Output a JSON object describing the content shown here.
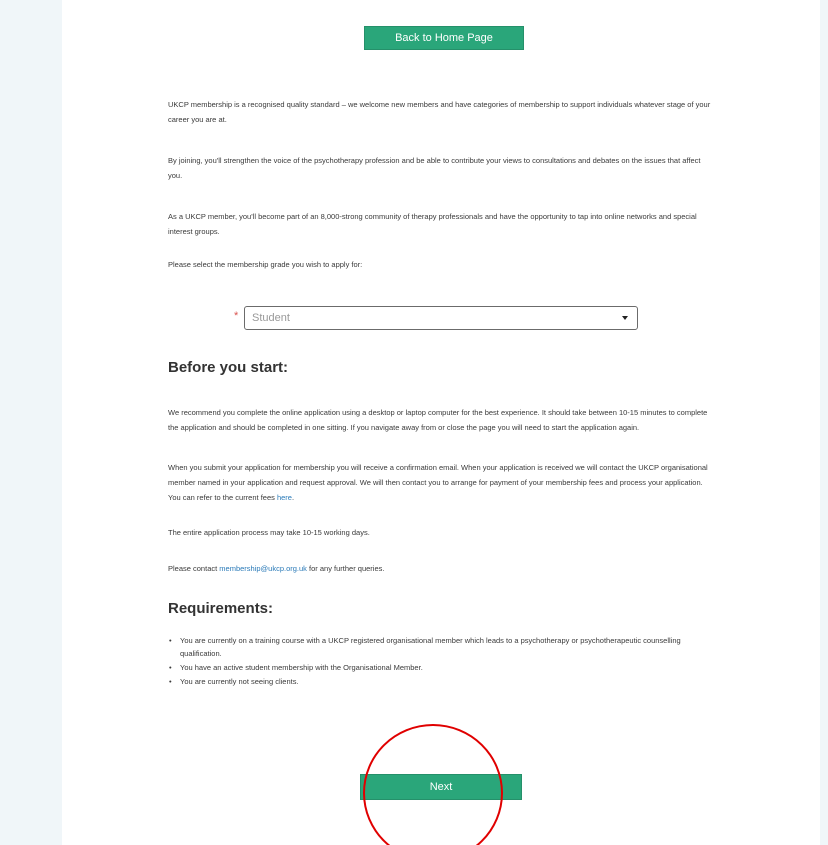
{
  "header": {
    "back_button_label": "Back to Home Page"
  },
  "intro": {
    "paragraphs": [
      "UKCP membership is a recognised quality standard – we welcome new members and have categories of membership to support individuals whatever stage of your career you are at.",
      "By joining, you'll strengthen the voice of the psychotherapy profession and be able to contribute your views to consultations and debates on the issues that affect you.",
      "As a UKCP member, you'll become part of an 8,000-strong community of therapy professionals and have the opportunity to tap into online networks and special interest groups.",
      "Please select the membership grade you wish to apply for:"
    ]
  },
  "grade_select": {
    "required_mark": "*",
    "selected_value": "Student"
  },
  "before_you_start": {
    "heading": "Before you start:",
    "p1": "We recommend you complete the online application using a desktop or laptop computer for the best experience. It should take between 10-15 minutes to complete the application and should be completed in one sitting. If you navigate away from or close the page you will need to start the application again.",
    "p2_text": "When you submit your application for membership you will receive a confirmation email. When your application is received we will contact the UKCP organisational member named in your application and request approval. We will then contact you to arrange for payment of your membership fees and process your application. You can refer to the current fees ",
    "p2_link": "here",
    "p2_end": ".",
    "p3": "The entire application process may take 10-15 working days.",
    "p4_text": "Please contact ",
    "p4_link": "membership@ukcp.org.uk",
    "p4_end": " for any further queries."
  },
  "requirements": {
    "heading": "Requirements:",
    "bullet": "•",
    "items": [
      "You are currently on a training course with a UKCP registered organisational member which leads to a psychotherapy or psychotherapeutic counselling qualification.",
      "You have an active student membership with the Organisational Member.",
      "You are currently not seeing clients."
    ]
  },
  "footer": {
    "next_label": "Next"
  },
  "colors": {
    "button_green": "#2aa67a",
    "annotation_red": "#e00000",
    "link_blue": "#2a7ab8",
    "page_background": "#f0f6f9"
  }
}
